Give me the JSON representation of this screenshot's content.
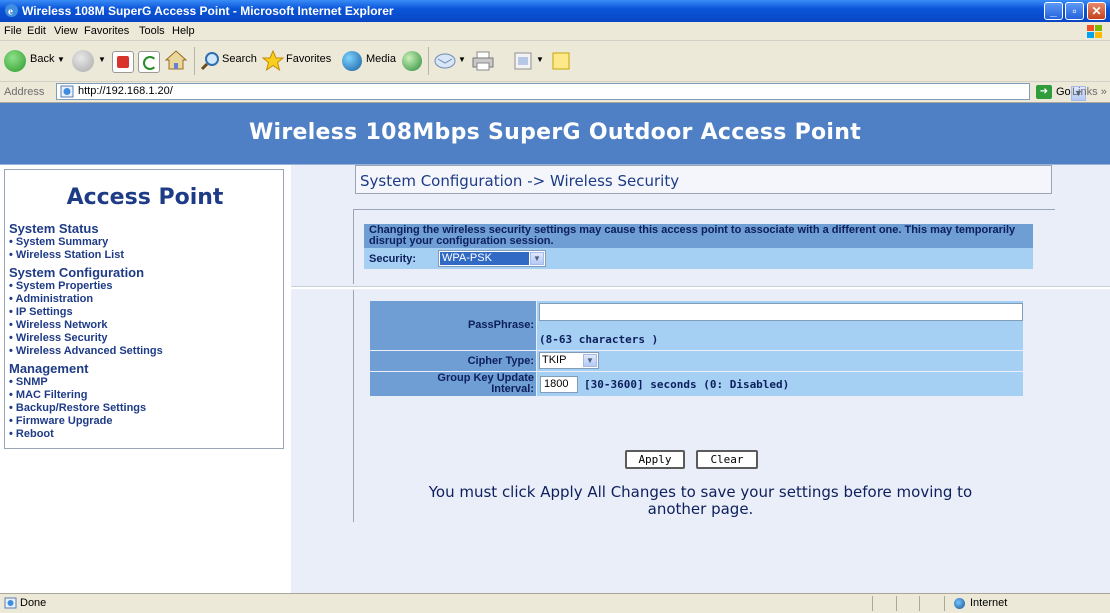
{
  "window": {
    "title": "Wireless 108M SuperG Access Point - Microsoft Internet Explorer",
    "controls": [
      "_",
      "▫",
      "✕"
    ]
  },
  "menu": [
    "File",
    "Edit",
    "View",
    "Favorites",
    "Tools",
    "Help"
  ],
  "toolbar": {
    "back_label": "Back",
    "search_label": "Search",
    "favorites_label": "Favorites",
    "media_label": "Media"
  },
  "address": {
    "label": "Address",
    "url": "http://192.168.1.20/",
    "go_label": "Go",
    "links_label": "Links »"
  },
  "page": {
    "banner_title": "Wireless 108Mbps SuperG Outdoor Access Point",
    "sidebar": {
      "title": "Access Point",
      "sections": [
        {
          "heading": "System Status",
          "items": [
            "System Summary",
            "Wireless Station List"
          ]
        },
        {
          "heading": "System Configuration",
          "items": [
            "System Properties",
            "Administration",
            "IP Settings",
            "Wireless Network",
            "Wireless Security",
            "Wireless Advanced Settings"
          ]
        },
        {
          "heading": "Management",
          "items": [
            "SNMP",
            "MAC Filtering",
            "Backup/Restore Settings",
            "Firmware Upgrade",
            "Reboot"
          ]
        }
      ]
    },
    "breadcrumb": "System Configuration -> Wireless Security",
    "warning": "Changing the wireless security settings may cause this access point to associate with a different one. This may temporarily disrupt your configuration session.",
    "security": {
      "label": "Security:",
      "value": "WPA-PSK"
    },
    "passphrase": {
      "label": "PassPhrase:",
      "value": "",
      "hint": "(8-63 characters )"
    },
    "cipher": {
      "label": "Cipher Type:",
      "value": "TKIP"
    },
    "group_key": {
      "label_line1": "Group Key Update",
      "label_line2": "Interval:",
      "value": "1800",
      "hint": "[30-3600] seconds (0: Disabled)"
    },
    "apply_label": "Apply",
    "clear_label": "Clear",
    "note_line1": "You must click Apply All Changes to save your settings before moving to",
    "note_line2": "another page."
  },
  "status": {
    "text": "Done",
    "zone": "Internet"
  },
  "colors": {
    "banner": "#4f7fc4",
    "label_cell": "#6e9ed3",
    "value_cell": "#a5cff3",
    "title_blue": "#1e3b86"
  }
}
